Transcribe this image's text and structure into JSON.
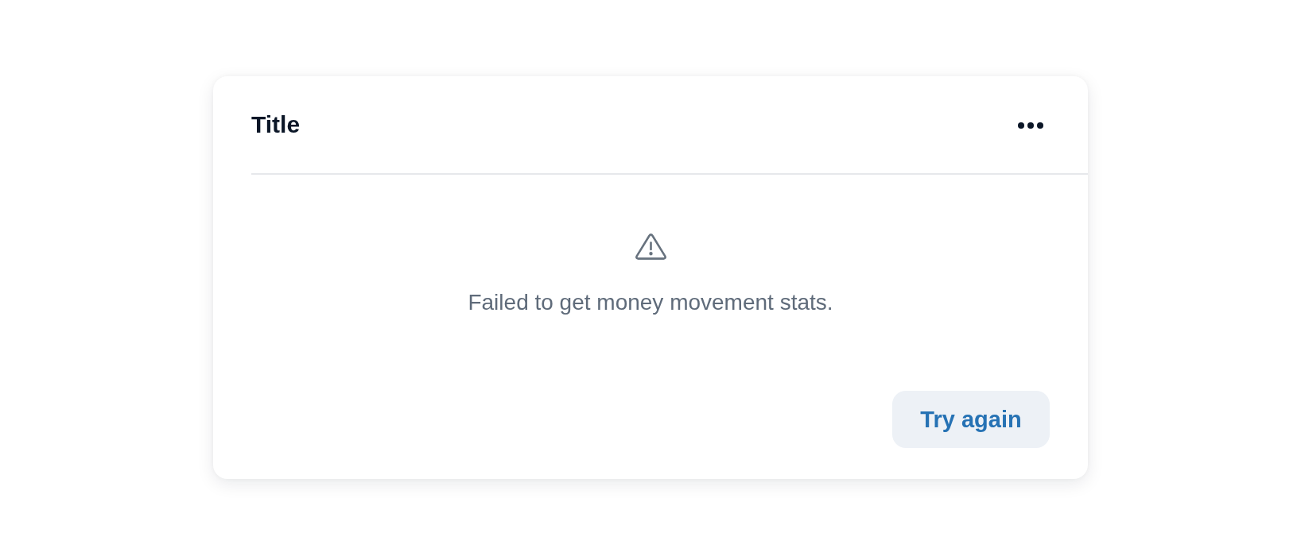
{
  "card": {
    "title": "Title",
    "error": {
      "message": "Failed to get money movement stats."
    },
    "action_button": {
      "label": "Try again"
    }
  }
}
